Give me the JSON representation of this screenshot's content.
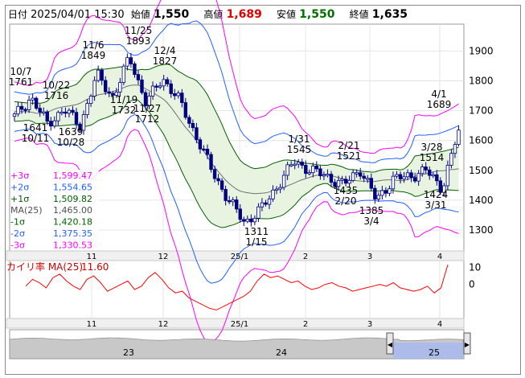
{
  "header": {
    "date_label": "日付",
    "datetime": "2025/04/01 15:30",
    "open_label": "始値",
    "open": "1,550",
    "high_label": "高値",
    "high": "1,689",
    "low_label": "安値",
    "low": "1,550",
    "close_label": "終値",
    "close": "1,635"
  },
  "colors": {
    "candle_up": "#ffffff",
    "candle_down": "#000080",
    "ma": "#707070",
    "sigma1": "#006000",
    "sigma2": "#2060ff",
    "sigma3": "#ff00ff",
    "band_fill": "#e8f4e0",
    "kairi": "#ff0000",
    "navigator_fill": "#a8b8f0"
  },
  "chart_data": [
    {
      "type": "candlestick",
      "ylim": [
        1230,
        1990
      ],
      "y_ticks": [
        "1900",
        "1800",
        "1700",
        "1600",
        "1500",
        "1400",
        "1300"
      ],
      "x_ticks": [
        "11",
        "12",
        "25/1",
        "2",
        "3",
        "4"
      ],
      "legend": [
        {
          "label": "+3σ",
          "value": "1,599.47"
        },
        {
          "label": "+2σ",
          "value": "1,554.65"
        },
        {
          "label": "+1σ",
          "value": "1,509.82"
        },
        {
          "label": "MA(25)",
          "value": "1,465.00"
        },
        {
          "label": "-1σ",
          "value": "1,420.18"
        },
        {
          "label": "-2σ",
          "value": "1,375.35"
        },
        {
          "label": "-3σ",
          "value": "1,330.53"
        }
      ],
      "annotations": [
        {
          "date": "10/7",
          "value": "1761"
        },
        {
          "date": "10/11",
          "value": "1641"
        },
        {
          "date": "10/22",
          "value": "1716"
        },
        {
          "date": "10/28",
          "value": "1639"
        },
        {
          "date": "11/6",
          "value": "1849"
        },
        {
          "date": "11/19",
          "value": "1732"
        },
        {
          "date": "11/25",
          "value": "1893"
        },
        {
          "date": "11/27",
          "value": "1712"
        },
        {
          "date": "12/4",
          "value": "1827"
        },
        {
          "date": "1/15",
          "value": "1311"
        },
        {
          "date": "1/31",
          "value": "1545"
        },
        {
          "date": "2/20",
          "value": "1435"
        },
        {
          "date": "2/21",
          "value": "1521"
        },
        {
          "date": "3/4",
          "value": "1385"
        },
        {
          "date": "3/28",
          "value": "1514"
        },
        {
          "date": "3/31",
          "value": "1424"
        },
        {
          "date": "4/1",
          "value": "1689"
        }
      ],
      "close_path": [
        {
          "date": "10/2",
          "close": 1680
        },
        {
          "date": "10/7",
          "close": 1745
        },
        {
          "date": "10/11",
          "close": 1655
        },
        {
          "date": "10/22",
          "close": 1705
        },
        {
          "date": "10/28",
          "close": 1650
        },
        {
          "date": "11/6",
          "close": 1820
        },
        {
          "date": "11/19",
          "close": 1745
        },
        {
          "date": "11/25",
          "close": 1880
        },
        {
          "date": "11/27",
          "close": 1725
        },
        {
          "date": "12/4",
          "close": 1810
        },
        {
          "date": "12/12",
          "close": 1735
        },
        {
          "date": "12/20",
          "close": 1620
        },
        {
          "date": "12/27",
          "close": 1500
        },
        {
          "date": "1/8",
          "close": 1400
        },
        {
          "date": "1/15",
          "close": 1325
        },
        {
          "date": "1/22",
          "close": 1370
        },
        {
          "date": "1/27",
          "close": 1450
        },
        {
          "date": "1/31",
          "close": 1530
        },
        {
          "date": "2/7",
          "close": 1500
        },
        {
          "date": "2/14",
          "close": 1480
        },
        {
          "date": "2/20",
          "close": 1450
        },
        {
          "date": "2/21",
          "close": 1505
        },
        {
          "date": "3/4",
          "close": 1400
        },
        {
          "date": "3/12",
          "close": 1470
        },
        {
          "date": "3/21",
          "close": 1480
        },
        {
          "date": "3/28",
          "close": 1500
        },
        {
          "date": "3/31",
          "close": 1440
        },
        {
          "date": "4/1",
          "close": 1635
        }
      ]
    },
    {
      "type": "line",
      "legend_label": "カイリ率 MA(25)",
      "legend_value": "11.60",
      "y_ticks": [
        "10",
        "0"
      ],
      "ylim": [
        -20,
        14
      ],
      "x_ticks": [
        "11",
        "12",
        "25/1",
        "2",
        "3",
        "4"
      ],
      "values": [
        -1,
        3,
        1,
        -2,
        4,
        6,
        2,
        -1,
        -3,
        3,
        5,
        1,
        -4,
        -2,
        0,
        2,
        -3,
        -1,
        4,
        7,
        3,
        -2,
        -5,
        -4,
        -8,
        -10,
        -12,
        -14,
        -15,
        -13,
        -11,
        -9,
        -7,
        -4,
        2,
        6,
        4,
        5,
        3,
        1,
        2,
        -1,
        -3,
        -2,
        0,
        1,
        -1,
        -2,
        -4,
        -3,
        -2,
        -1,
        0,
        -1,
        1,
        -2,
        -3,
        -4,
        -3,
        -1,
        -5,
        -2,
        11.6
      ]
    },
    {
      "type": "area",
      "x_ticks": [
        "23",
        "24",
        "25"
      ]
    }
  ]
}
